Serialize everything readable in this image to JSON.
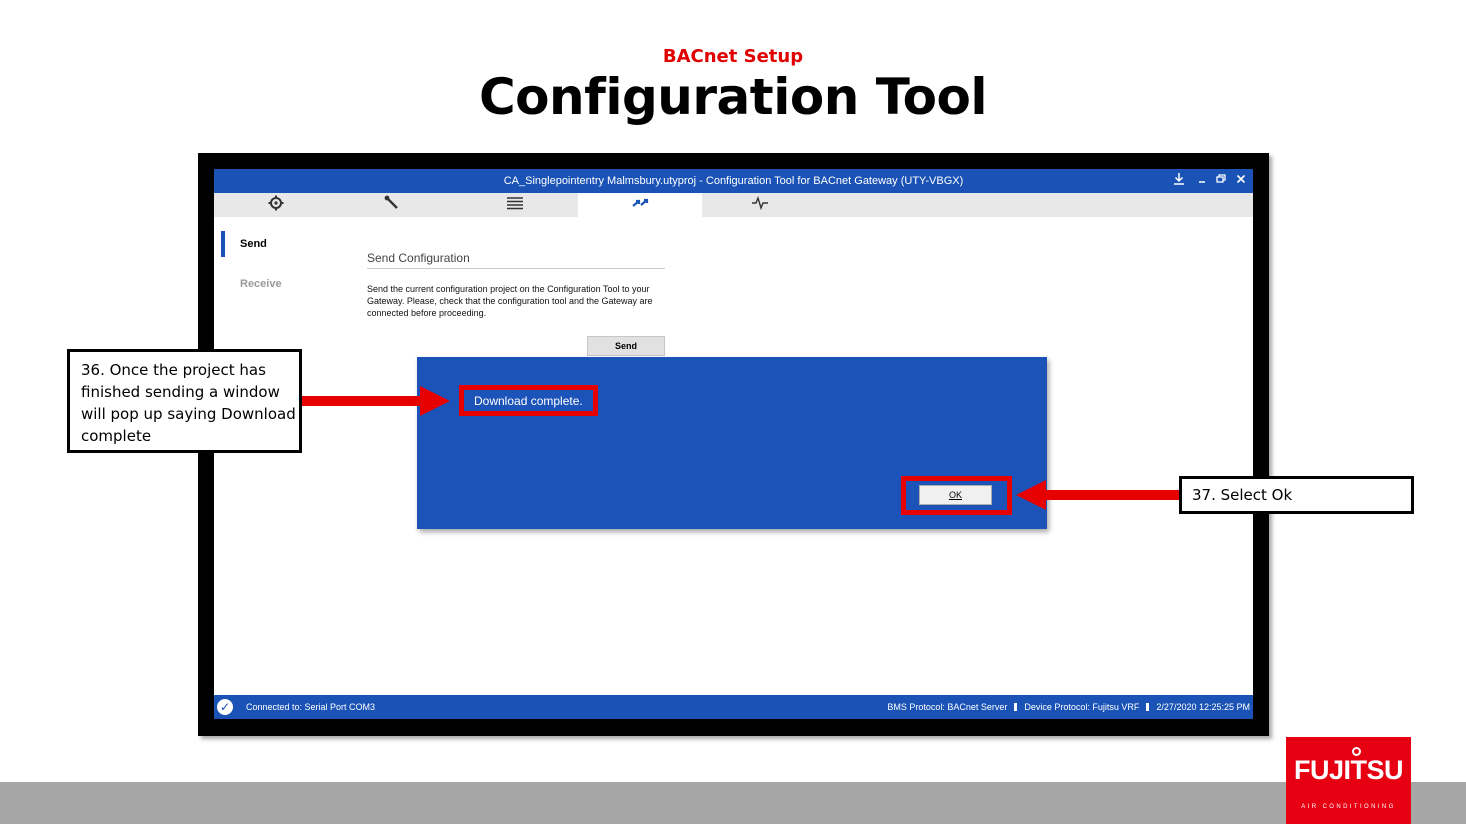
{
  "slide": {
    "subtitle": "BACnet Setup",
    "title": "Configuration Tool"
  },
  "window": {
    "title": "CA_Singlepointentry Malmsbury.utyproj - Configuration Tool for BACnet Gateway (UTY-VBGX)",
    "controls": [
      "download-icon",
      "minimize-icon",
      "restore-icon",
      "close-icon"
    ]
  },
  "toolbar": {
    "tabs": [
      {
        "icon": "gear-refresh-icon",
        "active": false
      },
      {
        "icon": "wrench-icon",
        "active": false
      },
      {
        "icon": "list-icon",
        "active": false
      },
      {
        "icon": "transfer-icon",
        "active": true
      },
      {
        "icon": "pulse-icon",
        "active": false
      }
    ]
  },
  "sidebar": {
    "items": [
      {
        "label": "Send",
        "active": true
      },
      {
        "label": "Receive",
        "active": false
      }
    ]
  },
  "main": {
    "heading": "Send Configuration",
    "description": "Send the current configuration project on the Configuration Tool to your Gateway. Please, check that the configuration tool and the Gateway are connected before proceeding.",
    "send_button": "Send"
  },
  "dialog": {
    "message": "Download complete.",
    "ok_button": "OK"
  },
  "status_bar": {
    "connection": "Connected to: Serial Port COM3",
    "bms_protocol": "BMS Protocol: BACnet Server",
    "device_protocol": "Device Protocol: Fujitsu VRF",
    "timestamp": "2/27/2020 12:25:25 PM"
  },
  "callouts": {
    "step36": "36. Once the project has finished sending a window will pop up saying Download complete",
    "step37": "37. Select Ok"
  },
  "logo": {
    "brand": "FUJITSU",
    "tagline": "AIR CONDITIONING"
  },
  "colors": {
    "accent_blue": "#1a53b5",
    "highlight_red": "#e60000",
    "footer_gray": "#a6a6a6"
  }
}
